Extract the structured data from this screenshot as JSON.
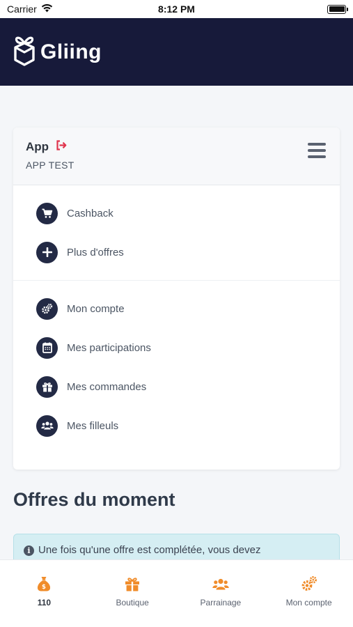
{
  "status_bar": {
    "carrier": "Carrier",
    "time": "8:12 PM"
  },
  "header": {
    "logo_text": "Gliing"
  },
  "card": {
    "title": "App",
    "subtitle": "APP TEST",
    "group1": [
      {
        "label": "Cashback",
        "icon": "cart-icon"
      },
      {
        "label": "Plus d'offres",
        "icon": "plus-icon"
      }
    ],
    "group2": [
      {
        "label": "Mon compte",
        "icon": "gears-icon"
      },
      {
        "label": "Mes participations",
        "icon": "calendar-icon"
      },
      {
        "label": "Mes commandes",
        "icon": "gift-icon"
      },
      {
        "label": "Mes filleuls",
        "icon": "users-icon"
      }
    ]
  },
  "section": {
    "title": "Offres du moment"
  },
  "alert": {
    "text": "Une fois qu'une offre est complétée, vous devez"
  },
  "tab_bar": {
    "tabs": [
      {
        "label": "110",
        "icon": "money-bag-icon"
      },
      {
        "label": "Boutique",
        "icon": "gift-icon"
      },
      {
        "label": "Parrainage",
        "icon": "users-icon"
      },
      {
        "label": "Mon compte",
        "icon": "gears-icon"
      }
    ]
  },
  "colors": {
    "header_bg": "#171a3a",
    "accent_orange": "#f08c2a",
    "icon_circle": "#232a45",
    "logout_red": "#e0344d",
    "alert_bg": "#d5eef3"
  }
}
